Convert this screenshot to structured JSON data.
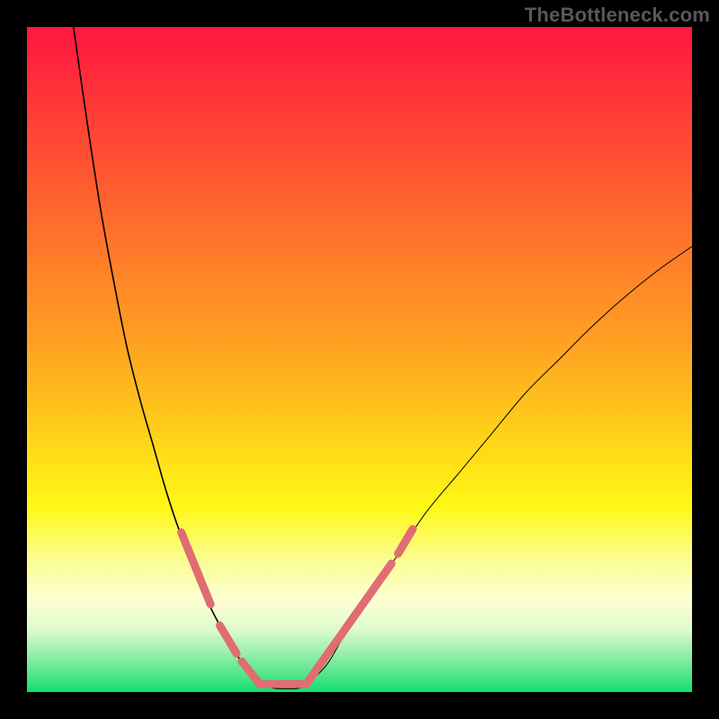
{
  "watermark": "TheBottleneck.com",
  "chart_data": {
    "type": "line",
    "title": "",
    "xlabel": "",
    "ylabel": "",
    "xlim": [
      0,
      100
    ],
    "ylim": [
      0,
      100
    ],
    "grid": false,
    "legend": false,
    "background_gradient": {
      "stops": [
        {
          "offset": 0.0,
          "color": "#ff163f"
        },
        {
          "offset": 0.48,
          "color": "#ffa321"
        },
        {
          "offset": 0.72,
          "color": "#fff714"
        },
        {
          "offset": 0.8,
          "color": "#fafd8f"
        },
        {
          "offset": 0.86,
          "color": "#fdffd3"
        },
        {
          "offset": 0.905,
          "color": "#e0fbcc"
        },
        {
          "offset": 0.955,
          "color": "#7ceb9e"
        },
        {
          "offset": 1.0,
          "color": "#12df6c"
        }
      ]
    },
    "series": [
      {
        "name": "curve-left",
        "color": "#000000",
        "width": 1.6,
        "x": [
          7,
          9,
          11,
          13,
          15,
          17,
          19,
          21,
          23,
          25,
          27,
          29,
          31,
          33,
          35
        ],
        "y": [
          100,
          86,
          73,
          62,
          52,
          44,
          37,
          30,
          24,
          19,
          14,
          10,
          6.5,
          3.5,
          1.2
        ]
      },
      {
        "name": "curve-right",
        "color": "#000000",
        "width": 1.0,
        "x": [
          42,
          45,
          48,
          52,
          56,
          60,
          65,
          70,
          75,
          80,
          85,
          90,
          95,
          100
        ],
        "y": [
          1.2,
          4,
          9,
          15,
          21,
          27,
          33,
          39,
          45,
          50,
          55,
          59.5,
          63.5,
          67
        ]
      },
      {
        "name": "valley-floor",
        "color": "#000000",
        "width": 1.2,
        "x": [
          35,
          37,
          39,
          41,
          42
        ],
        "y": [
          1.2,
          0.6,
          0.5,
          0.6,
          1.2
        ]
      },
      {
        "name": "pink-left-upper",
        "color": "#e06d72",
        "width": 9,
        "linecap": "round",
        "x": [
          23.2,
          27.6
        ],
        "y": [
          24.0,
          13.2
        ]
      },
      {
        "name": "pink-left-lower",
        "color": "#e06d72",
        "width": 9,
        "linecap": "round",
        "x": [
          29.0,
          31.5
        ],
        "y": [
          10.0,
          5.8
        ]
      },
      {
        "name": "pink-left-bottom",
        "color": "#e06d72",
        "width": 9,
        "linecap": "round",
        "x": [
          32.3,
          35.0
        ],
        "y": [
          4.6,
          1.2
        ]
      },
      {
        "name": "pink-floor",
        "color": "#e06d72",
        "width": 9,
        "linecap": "round",
        "x": [
          35.0,
          42.0
        ],
        "y": [
          1.2,
          1.2
        ]
      },
      {
        "name": "pink-right",
        "color": "#e06d72",
        "width": 9,
        "linecap": "round",
        "x": [
          42.0,
          54.8
        ],
        "y": [
          1.2,
          19.3
        ]
      },
      {
        "name": "pink-right-top",
        "color": "#e06d72",
        "width": 9,
        "linecap": "round",
        "x": [
          55.8,
          58.0
        ],
        "y": [
          20.8,
          24.5
        ]
      }
    ]
  }
}
